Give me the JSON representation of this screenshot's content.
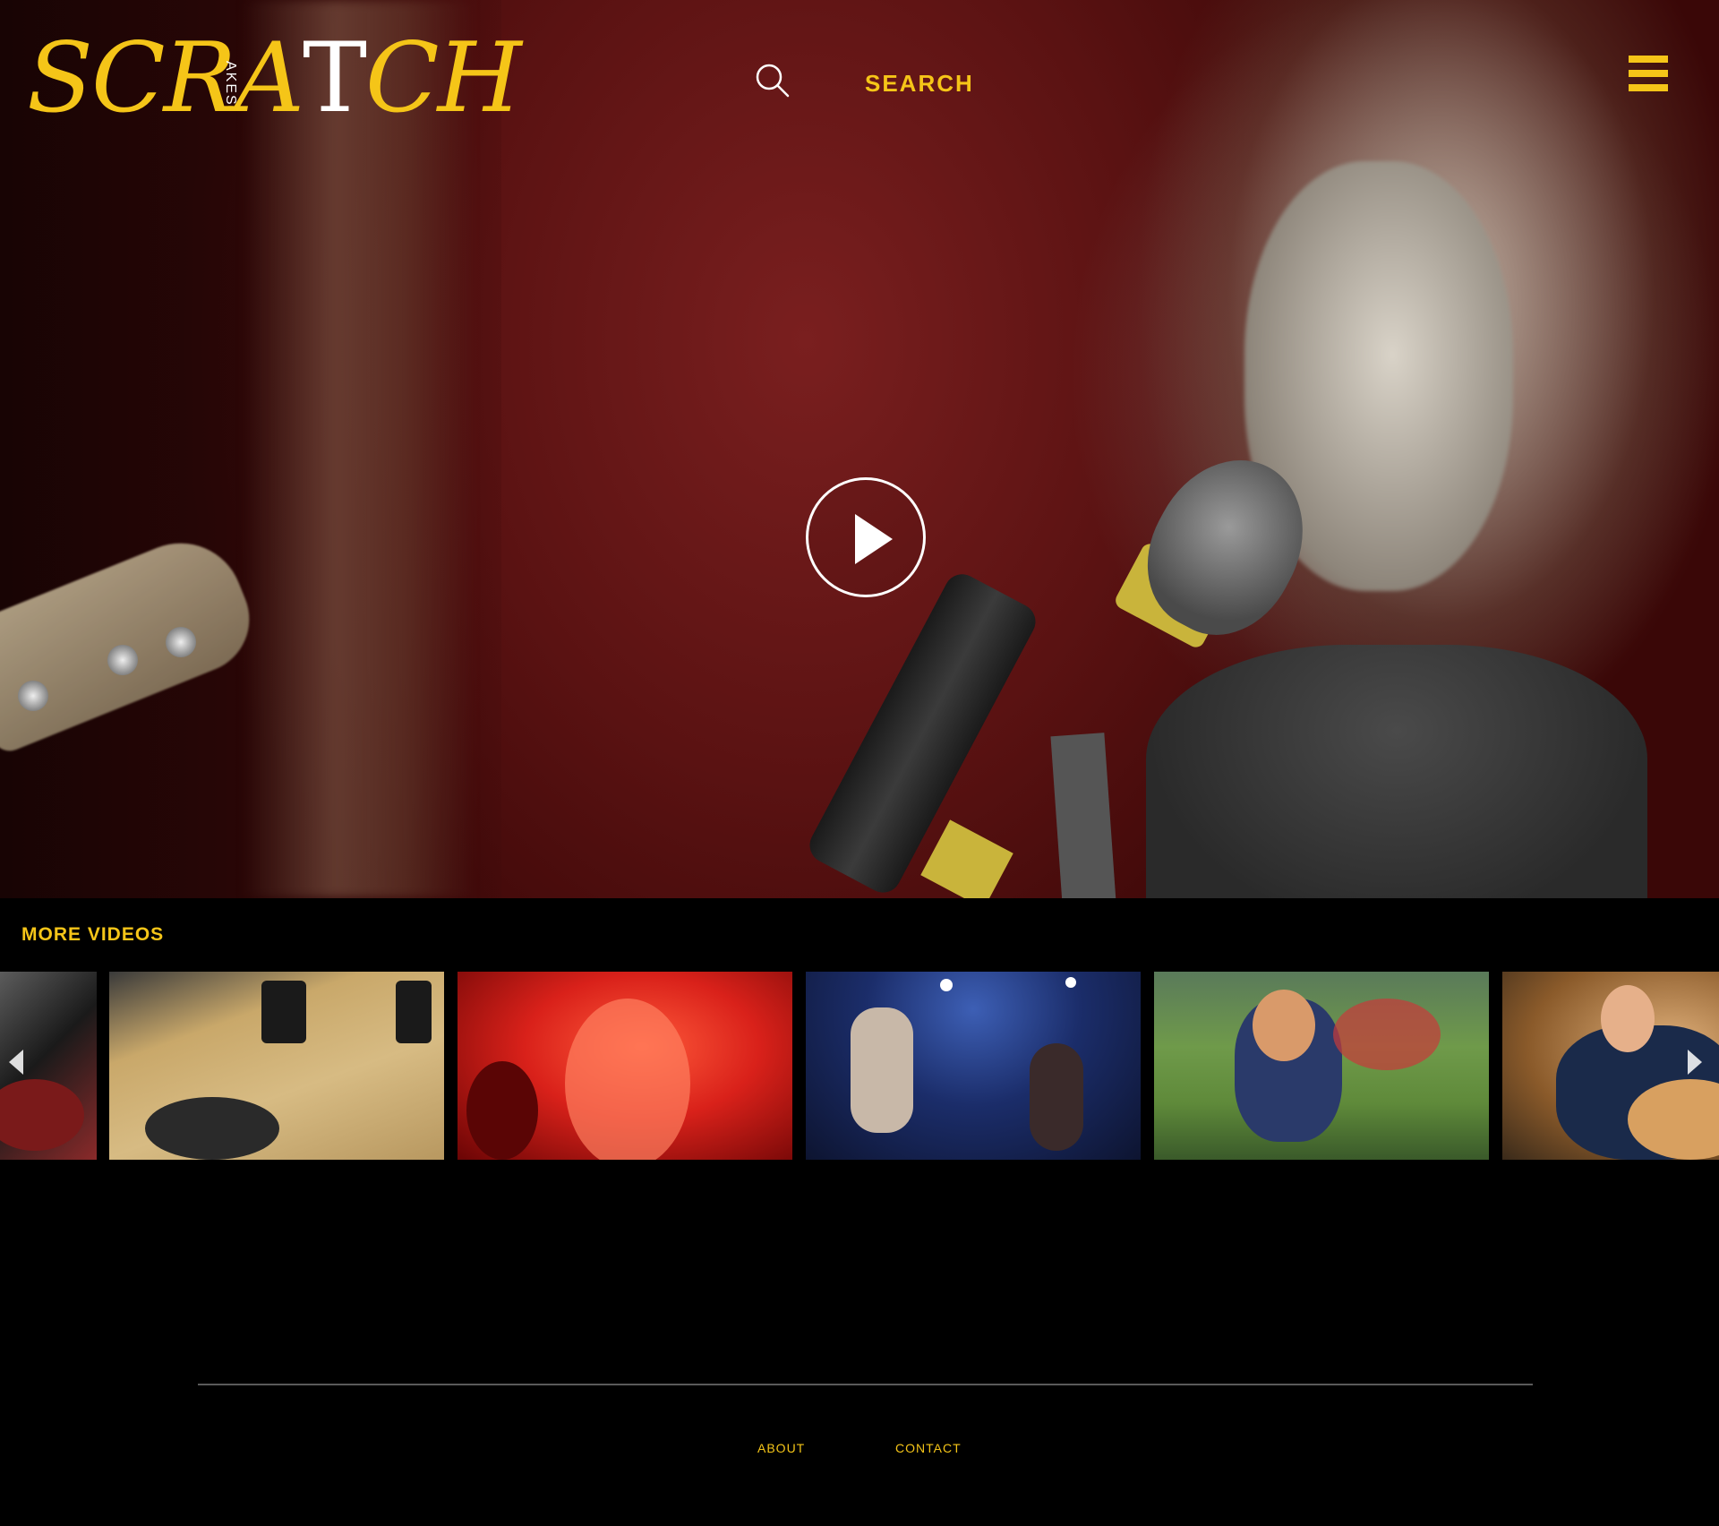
{
  "brand": {
    "logo_main": "SCRA",
    "logo_t": "T",
    "logo_end": "CH",
    "logo_takes": "AKES"
  },
  "header": {
    "search_label": "SEARCH",
    "search_icon": "search-icon",
    "menu_icon": "hamburger-menu-icon"
  },
  "hero": {
    "play_icon": "play-icon"
  },
  "more_videos": {
    "title": "MORE VIDEOS",
    "prev_icon": "chevron-left-icon",
    "next_icon": "chevron-right-icon",
    "thumbnail_count": 6
  },
  "footer": {
    "about": "ABOUT",
    "contact": "CONTACT"
  },
  "colors": {
    "accent": "#f5c518",
    "background": "#000000",
    "divider": "#5a5a5a"
  }
}
